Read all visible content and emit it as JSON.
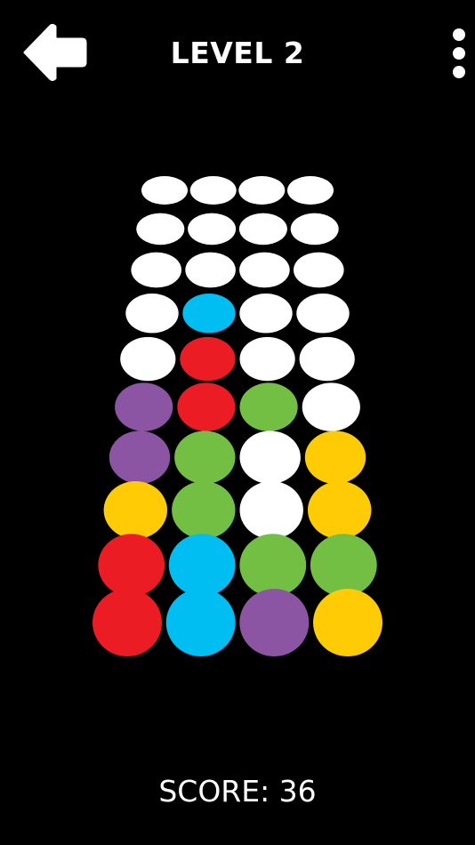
{
  "header": {
    "title": "LEVEL 2"
  },
  "footer": {
    "score_text": "SCORE: 36"
  },
  "colors": {
    "background": "#000000",
    "W": "#ffffff",
    "B": "#00bdf2",
    "R": "#ec1c24",
    "P": "#8c55a4",
    "G": "#72bf44",
    "Y": "#ffcb05"
  },
  "board": {
    "rows": [
      [
        "W",
        "W",
        "W",
        "W"
      ],
      [
        "W",
        "W",
        "W",
        "W"
      ],
      [
        "W",
        "W",
        "W",
        "W"
      ],
      [
        "W",
        "B",
        "W",
        "W"
      ],
      [
        "W",
        "R",
        "W",
        "W"
      ],
      [
        "P",
        "R",
        "G",
        "W"
      ],
      [
        "P",
        "G",
        "W",
        "Y"
      ],
      [
        "Y",
        "G",
        "W",
        "Y"
      ],
      [
        "R",
        "B",
        "G",
        "G"
      ],
      [
        "R",
        "B",
        "P",
        "Y"
      ]
    ]
  }
}
